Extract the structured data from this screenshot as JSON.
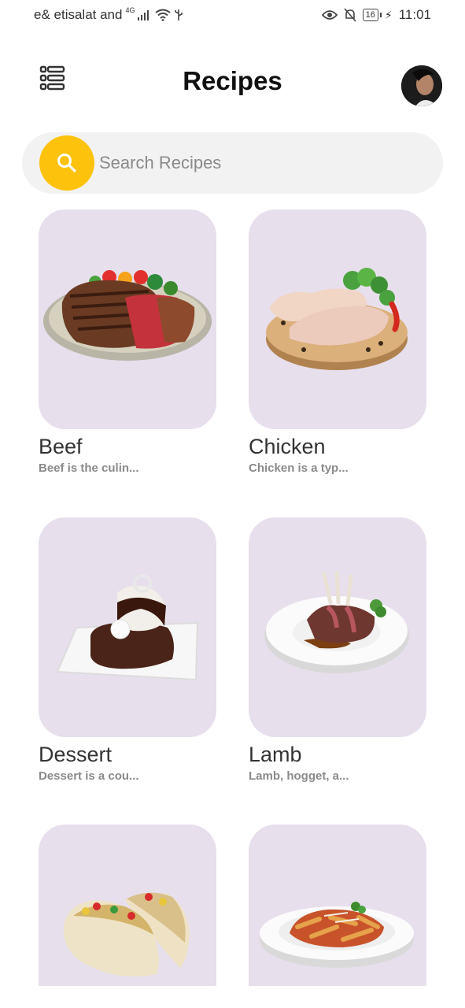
{
  "status_bar": {
    "carrier": "e& etisalat and",
    "network": "4G",
    "battery": "16",
    "time": "11:01"
  },
  "header": {
    "title": "Recipes",
    "menu_icon": "menu-list-icon",
    "avatar": "user-avatar"
  },
  "search": {
    "placeholder": "Search Recipes",
    "value": "",
    "icon": "search-icon",
    "accent": "#fdc20c"
  },
  "colors": {
    "card_background": "#e7dfec",
    "search_background": "#f2f2f2"
  },
  "categories": [
    {
      "name": "Beef",
      "description": "Beef is the culin..."
    },
    {
      "name": "Chicken",
      "description": "Chicken is a typ..."
    },
    {
      "name": "Dessert",
      "description": "Dessert is a cou..."
    },
    {
      "name": "Lamb",
      "description": "Lamb, hogget, a..."
    },
    {
      "name": "",
      "description": ""
    },
    {
      "name": "",
      "description": ""
    }
  ]
}
